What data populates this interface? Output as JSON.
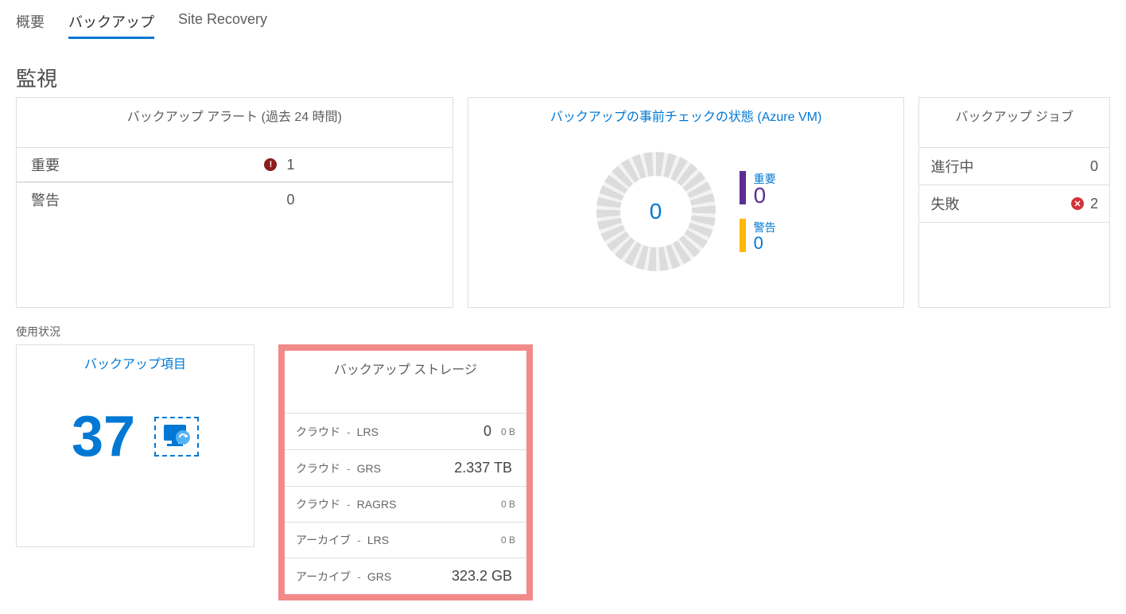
{
  "tabs": {
    "overview": "概要",
    "backup": "バックアップ",
    "site_recovery": "Site Recovery"
  },
  "monitoring": {
    "title": "監視",
    "alerts": {
      "title": "バックアップ アラート (過去 24 時間)",
      "critical_label": "重要",
      "critical_count": "1",
      "warning_label": "警告",
      "warning_count": "0"
    },
    "precheck": {
      "title": "バックアップの事前チェックの状態 (Azure VM)",
      "center_value": "0",
      "critical_label": "重要",
      "critical_value": "0",
      "warning_label": "警告",
      "warning_value": "0"
    },
    "jobs": {
      "title": "バックアップ ジョブ",
      "inprogress_label": "進行中",
      "inprogress_count": "0",
      "failed_label": "失敗",
      "failed_count": "2"
    }
  },
  "usage": {
    "label": "使用状況",
    "items": {
      "title": "バックアップ項目",
      "count": "37"
    },
    "storage": {
      "title": "バックアップ ストレージ",
      "rows": [
        {
          "cat": "クラウド",
          "type": "LRS",
          "big": "0",
          "small": "0 B"
        },
        {
          "cat": "クラウド",
          "type": "GRS",
          "big": "2.337 TB",
          "small": ""
        },
        {
          "cat": "クラウド",
          "type": "RAGRS",
          "big": "",
          "small": "0 B"
        },
        {
          "cat": "アーカイブ",
          "type": "LRS",
          "big": "",
          "small": "0 B"
        },
        {
          "cat": "アーカイブ",
          "type": "GRS",
          "big": "323.2 GB",
          "small": ""
        }
      ]
    }
  }
}
